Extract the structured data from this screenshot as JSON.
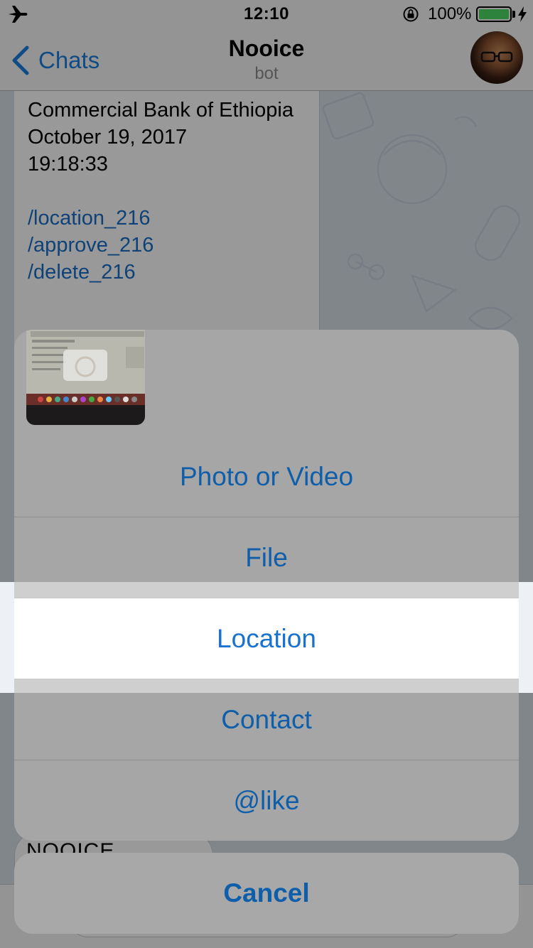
{
  "status_bar": {
    "time": "12:10",
    "battery_percent": "100%",
    "battery_level": 1.0,
    "battery_color": "#4cd964",
    "icons": [
      "airplane-icon",
      "rotation-lock-icon",
      "battery-icon",
      "charging-bolt-icon"
    ]
  },
  "nav": {
    "back_label": "Chats",
    "title": "Nooice",
    "subtitle": "bot",
    "back_icon": "chevron-left-icon"
  },
  "message": {
    "lines": [
      "Commercial Bank of Ethiopia",
      "October 19, 2017",
      "19:18:33"
    ],
    "commands": [
      "/location_216",
      "/approve_216",
      "/delete_216"
    ]
  },
  "peek_message": {
    "text": "NOOICE"
  },
  "action_sheet": {
    "items": [
      {
        "label": "Photo or Video"
      },
      {
        "label": "File"
      },
      {
        "label": "Location"
      },
      {
        "label": "Contact"
      },
      {
        "label": "@like"
      }
    ],
    "highlighted": "Location",
    "cancel_label": "Cancel"
  },
  "colors": {
    "accent": "#1a7fe0",
    "link": "#1a6fc8",
    "sheet_text": "#0f5eaa"
  }
}
